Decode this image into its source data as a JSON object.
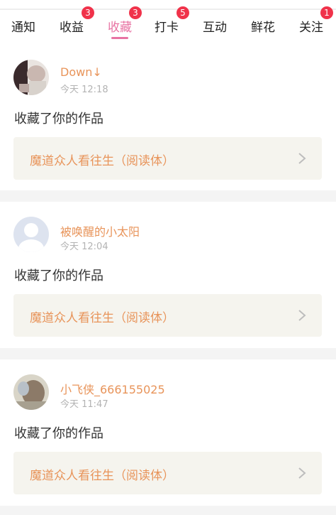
{
  "tabs": [
    {
      "label": "通知",
      "badge": "",
      "active": false
    },
    {
      "label": "收益",
      "badge": "3",
      "active": false
    },
    {
      "label": "收藏",
      "badge": "3",
      "active": true
    },
    {
      "label": "打卡",
      "badge": "5",
      "active": false
    },
    {
      "label": "互动",
      "badge": "",
      "active": false
    },
    {
      "label": "鲜花",
      "badge": "",
      "active": false
    },
    {
      "label": "关注",
      "badge": "1",
      "active": false
    }
  ],
  "notifications": [
    {
      "username": "Down↓",
      "time": "今天 12:18",
      "action": "收藏了你的作品",
      "work_title": "魔道众人看往生（阅读体）"
    },
    {
      "username": "被唤醒的小太阳",
      "time": "今天 12:04",
      "action": "收藏了你的作品",
      "work_title": "魔道众人看往生（阅读体）"
    },
    {
      "username": "小飞侠_666155025",
      "time": "今天 11:47",
      "action": "收藏了你的作品",
      "work_title": "魔道众人看往生（阅读体）"
    }
  ],
  "colors": {
    "accent": "#e873a3",
    "badge": "#f0324a",
    "username": "#e8945a",
    "work_bg": "#f5f4ee"
  }
}
